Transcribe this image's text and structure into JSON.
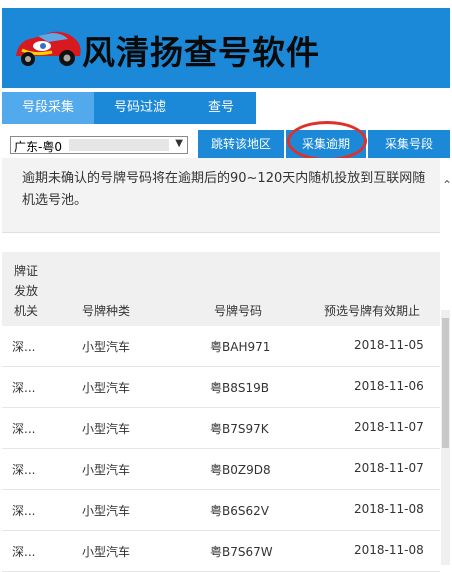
{
  "app": {
    "title": "风清扬查号软件"
  },
  "tabs": [
    {
      "label": "号段采集",
      "active": true
    },
    {
      "label": "号码过滤",
      "active": false
    },
    {
      "label": "查号",
      "active": false
    }
  ],
  "toolbar": {
    "region_selected": "广东-粤0",
    "buttons": [
      "跳转该地区",
      "采集逾期",
      "采集号段"
    ]
  },
  "notice": "逾期未确认的号牌号码将在逾期后的90~120天内随机投放到互联网随机选号池。",
  "table": {
    "headers": {
      "authority": [
        "牌证",
        "发放",
        "机关"
      ],
      "type": "号牌种类",
      "plate": "号牌号码",
      "expiry": "预选号牌有效期止"
    },
    "rows": [
      {
        "authority": "深...",
        "type": "小型汽车",
        "plate": "粤BAH971",
        "expiry": "2018-11-05"
      },
      {
        "authority": "深...",
        "type": "小型汽车",
        "plate": "粤B8S19B",
        "expiry": "2018-11-06"
      },
      {
        "authority": "深...",
        "type": "小型汽车",
        "plate": "粤B7S97K",
        "expiry": "2018-11-07"
      },
      {
        "authority": "深...",
        "type": "小型汽车",
        "plate": "粤B0Z9D8",
        "expiry": "2018-11-07"
      },
      {
        "authority": "深...",
        "type": "小型汽车",
        "plate": "粤B6S62V",
        "expiry": "2018-11-08"
      },
      {
        "authority": "深...",
        "type": "小型汽车",
        "plate": "粤B7S67W",
        "expiry": "2018-11-08"
      }
    ]
  },
  "colors": {
    "header_blue": "#1b88d8",
    "active_tab": "#52a9ec",
    "highlight_circle": "#e0302a"
  },
  "icons": [
    "car-logo-icon",
    "chevron-down-icon",
    "scroll-up-icon"
  ]
}
